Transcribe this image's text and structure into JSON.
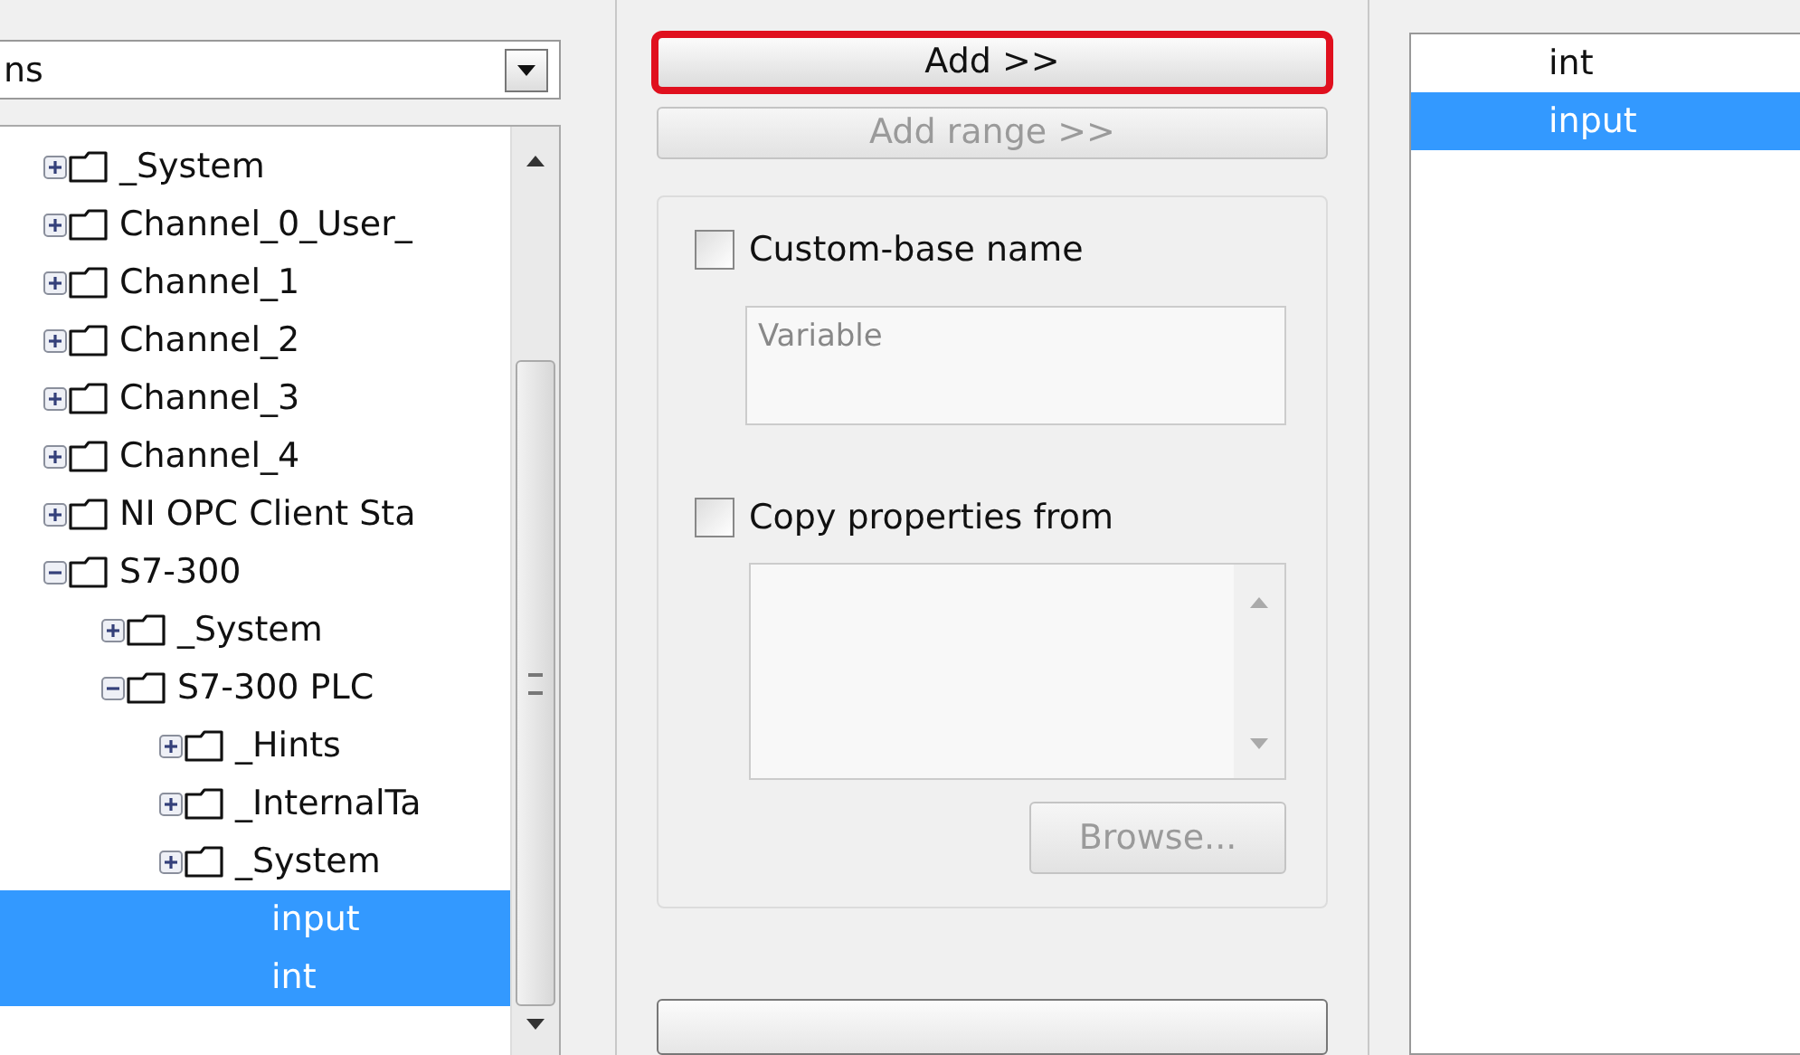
{
  "source": {
    "combo_value": "ns",
    "tree": [
      {
        "label": "_System",
        "expanded": false,
        "selected": false
      },
      {
        "label": "Channel_0_User_",
        "expanded": false,
        "selected": false
      },
      {
        "label": "Channel_1",
        "expanded": false,
        "selected": false
      },
      {
        "label": "Channel_2",
        "expanded": false,
        "selected": false
      },
      {
        "label": "Channel_3",
        "expanded": false,
        "selected": false
      },
      {
        "label": "Channel_4",
        "expanded": false,
        "selected": false
      },
      {
        "label": "NI OPC Client Sta",
        "expanded": false,
        "selected": false
      },
      {
        "label": "S7-300",
        "expanded": true,
        "selected": false,
        "children": [
          {
            "label": "_System",
            "expanded": false,
            "selected": false
          },
          {
            "label": "S7-300 PLC",
            "expanded": true,
            "selected": false,
            "children": [
              {
                "label": "_Hints",
                "expanded": false,
                "selected": false
              },
              {
                "label": "_InternalTa",
                "expanded": false,
                "selected": false
              },
              {
                "label": "_System",
                "expanded": false,
                "selected": false
              },
              {
                "label": "input",
                "kind": "leaf",
                "selected": true
              },
              {
                "label": "int",
                "kind": "leaf",
                "selected": true
              }
            ]
          }
        ]
      }
    ]
  },
  "actions": {
    "add_button": {
      "label": "Add >>",
      "highlighted": true,
      "disabled": false
    },
    "add_range_button": {
      "label": "Add range >>",
      "disabled": true
    },
    "custom_base": {
      "label": "Custom-base name",
      "checked": false,
      "placeholder": "Variable"
    },
    "copy_properties": {
      "label": "Copy properties from",
      "checked": false
    },
    "browse_button": {
      "label": "Browse...",
      "disabled": true
    }
  },
  "added_variables": [
    {
      "label": "int",
      "selected": false
    },
    {
      "label": "input",
      "selected": true
    }
  ]
}
